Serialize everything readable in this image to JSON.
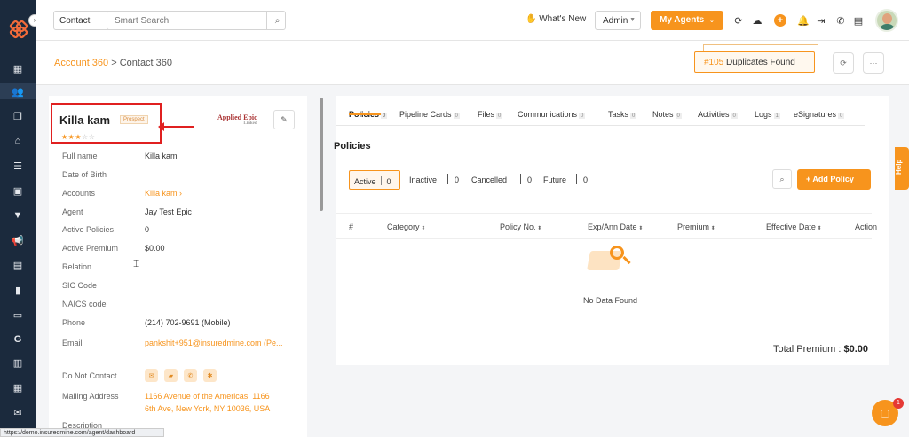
{
  "topbar": {
    "contact_select": "Contact",
    "search_placeholder": "Smart Search",
    "whats_new": "What's New",
    "admin_select": "Admin",
    "my_agents": "My Agents"
  },
  "breadcrumb": {
    "parent": "Account 360",
    "separator": " > ",
    "current": "Contact 360"
  },
  "duplicates": {
    "number": "#105",
    "label": "Duplicates Found"
  },
  "contact": {
    "name": "Killa kam",
    "status_badge": "Prospect",
    "rating": 3,
    "rating_max": 5,
    "agency_logo": "Applied Epic",
    "agency_logo_sub": "Linked",
    "fields": [
      {
        "label": "Full name",
        "value": "Killa kam"
      },
      {
        "label": "Date of Birth",
        "value": ""
      },
      {
        "label": "Accounts",
        "value": "Killa kam ›"
      },
      {
        "label": "Agent",
        "value": "Jay Test Epic"
      },
      {
        "label": "Active Policies",
        "value": "0"
      },
      {
        "label": "Active Premium",
        "value": "$0.00"
      },
      {
        "label": "Relation",
        "value": ""
      },
      {
        "label": "SIC Code",
        "value": ""
      },
      {
        "label": "NAICS code",
        "value": ""
      },
      {
        "label": "Phone",
        "value": "(214) 702-9691 (Mobile)"
      },
      {
        "label": "Email",
        "value": "pankshit+951@insuredmine.com (Pe..."
      }
    ],
    "do_not_contact_label": "Do Not Contact",
    "mailing_address_label": "Mailing Address",
    "mailing_address_line1": "1166 Avenue of the Americas, 1166",
    "mailing_address_line2": "6th Ave, New York, NY 10036, USA",
    "description_label": "Description"
  },
  "tabs": [
    {
      "label": "Policies",
      "count": "0"
    },
    {
      "label": "Pipeline Cards",
      "count": "0"
    },
    {
      "label": "Files",
      "count": "0"
    },
    {
      "label": "Communications",
      "count": "0"
    },
    {
      "label": "Tasks",
      "count": "0"
    },
    {
      "label": "Notes",
      "count": "0"
    },
    {
      "label": "Activities",
      "count": "0"
    },
    {
      "label": "Logs",
      "count": "1"
    },
    {
      "label": "eSignatures",
      "count": "0"
    }
  ],
  "policies": {
    "title": "Policies",
    "filters": [
      {
        "label": "Active",
        "count": "0"
      },
      {
        "label": "Inactive",
        "count": "0"
      },
      {
        "label": "Cancelled",
        "count": "0"
      },
      {
        "label": "Future",
        "count": "0"
      }
    ],
    "add_button": "+ Add Policy",
    "columns": [
      "#",
      "Category",
      "Policy No.",
      "Exp/Ann Date",
      "Premium",
      "Effective Date",
      "Action"
    ],
    "empty_text": "No Data Found",
    "total_label": "Total Premium :",
    "total_value": "$0.00"
  },
  "help_label": "Help",
  "chat_badge": "1",
  "status_url": "https://demo.insuredmine.com/agent/dashboard",
  "colors": {
    "accent": "#f7941d",
    "sidebar": "#1b2a3d",
    "highlight": "#e02020"
  }
}
